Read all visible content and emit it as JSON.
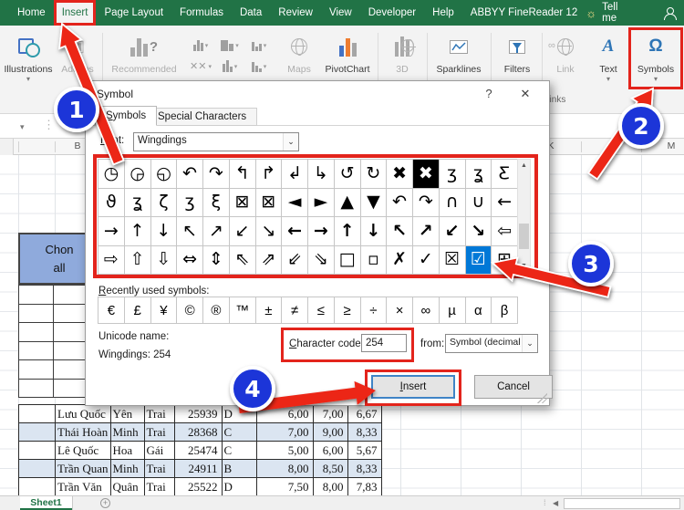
{
  "menubar": {
    "tabs": [
      {
        "label": "Home",
        "active": false
      },
      {
        "label": "Insert",
        "active": true
      },
      {
        "label": "Page Layout",
        "active": false
      },
      {
        "label": "Formulas",
        "active": false
      },
      {
        "label": "Data",
        "active": false
      },
      {
        "label": "Review",
        "active": false
      },
      {
        "label": "View",
        "active": false
      },
      {
        "label": "Developer",
        "active": false
      },
      {
        "label": "Help",
        "active": false
      },
      {
        "label": "ABBYY FineReader 12",
        "active": false
      }
    ],
    "tell_me": "Tell me"
  },
  "ribbon": {
    "illustrations": "Illustrations",
    "addins": "Add-ins",
    "recommended": "Recommended",
    "maps": "Maps",
    "pivotchart": "PivotChart",
    "threed": "3D",
    "sparklines": "Sparklines",
    "filters": "Filters",
    "link": "Link",
    "text": "Text",
    "symbols": "Symbols",
    "links_group": "Links"
  },
  "icons": {
    "omega": "Ω",
    "text_a": "A",
    "bulb": "☼",
    "chevron": "▾",
    "dots": "⋮",
    "cancel_x": "✕",
    "help": "?",
    "close": "✕",
    "combo_chevron": "⌄",
    "scroll_up": "▲",
    "scroll_down": "▼",
    "scroll_left": "◀",
    "plus": "+",
    "question": "?"
  },
  "dialog": {
    "title": "Symbol",
    "tabs": [
      "Symbols",
      "Special Characters"
    ],
    "font_label": "Font:",
    "font_value": "Wingdings",
    "grid": {
      "rows": [
        [
          "◷",
          "◶",
          "◵",
          "↶",
          "↷",
          "↰",
          "↱",
          "↲",
          "↳",
          "↺",
          "↻",
          "✖",
          "✖",
          "ʒ",
          "ʓ",
          "Ƹ"
        ],
        [
          "ϑ",
          "ʓ",
          "ζ",
          "ʒ",
          "ξ",
          "⊠",
          "⊠",
          "◄",
          "►",
          "▲",
          "▼",
          "↶",
          "↷",
          "∩",
          "∪",
          "←"
        ],
        [
          "→",
          "↑",
          "↓",
          "↖",
          "↗",
          "↙",
          "↘",
          "←",
          "→",
          "↑",
          "↓",
          "↖",
          "↗",
          "↙",
          "↘",
          "⇦"
        ],
        [
          "⇨",
          "⇧",
          "⇩",
          "⇔",
          "⇕",
          "⇖",
          "⇗",
          "⇙",
          "⇘",
          "□",
          "▫",
          "✗",
          "✓",
          "☒",
          "☑",
          "⊞"
        ]
      ],
      "inverse_cell": [
        0,
        12
      ],
      "selected_cell": [
        3,
        14
      ],
      "bold_cells": [
        [
          2,
          7
        ],
        [
          2,
          8
        ],
        [
          2,
          9
        ],
        [
          2,
          10
        ],
        [
          2,
          11
        ],
        [
          2,
          12
        ],
        [
          2,
          13
        ],
        [
          2,
          14
        ]
      ]
    },
    "recent_label": "Recently used symbols:",
    "recent_symbols": [
      "€",
      "£",
      "¥",
      "©",
      "®",
      "™",
      "±",
      "≠",
      "≤",
      "≥",
      "÷",
      "×",
      "∞",
      "µ",
      "α",
      "β"
    ],
    "unicode_name_label": "Unicode name:",
    "unicode_name_value": "Wingdings: 254",
    "char_code_label": "Character code:",
    "char_code_value": "254",
    "from_label": "from:",
    "from_value": "Symbol (decimal)",
    "insert_label": "Insert",
    "cancel_label": "Cancel"
  },
  "sheet": {
    "col_headers": [
      "B",
      "K",
      "L",
      "M"
    ],
    "select_all_cell": {
      "line1": "Chon",
      "line2": "all"
    },
    "table": {
      "rows": [
        [
          "",
          "Lưu Quốc",
          "Yên",
          "Trai",
          "25939",
          "D",
          "6,00",
          "7,00",
          "6,67"
        ],
        [
          "",
          "Thái Hoàn",
          "Minh",
          "Trai",
          "28368",
          "C",
          "7,00",
          "9,00",
          "8,33"
        ],
        [
          "",
          "Lê Quốc",
          "Hoa",
          "Gái",
          "25474",
          "C",
          "5,00",
          "6,00",
          "5,67"
        ],
        [
          "",
          "Trần Quan",
          "Minh",
          "Trai",
          "24911",
          "B",
          "8,00",
          "8,50",
          "8,33"
        ],
        [
          "",
          "Trần Văn",
          "Quân",
          "Trai",
          "25522",
          "D",
          "7,50",
          "8,00",
          "7,83"
        ]
      ],
      "shaded_rows": [
        1,
        3
      ]
    },
    "tab_name": "Sheet1"
  },
  "callouts": [
    {
      "number": "1"
    },
    {
      "number": "2"
    },
    {
      "number": "3"
    },
    {
      "number": "4"
    }
  ],
  "colors": {
    "excel_green": "#217346",
    "annotation_red": "#e3241c",
    "callout_blue": "#1a36d8",
    "selection_blue": "#0078d7",
    "band_blue": "#dbe5f1",
    "select_all_fill": "#8faadc"
  }
}
